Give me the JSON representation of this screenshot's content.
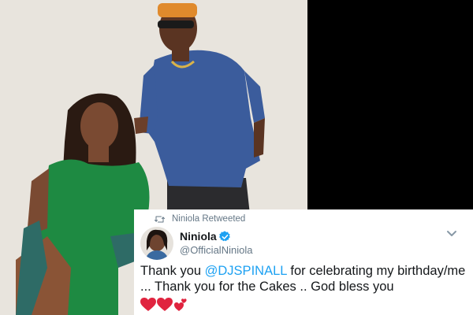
{
  "retweet": {
    "label": "Niniola Retweeted",
    "icon": "retweet-icon"
  },
  "author": {
    "name": "Niniola",
    "handle": "@OfficialNiniola",
    "verified_icon": "verified-badge-icon"
  },
  "tweet": {
    "line1_prefix": "Thank you ",
    "mention": "@DJSPINALL",
    "line1_suffix": " for celebrating my birthday/me",
    "line2": "... Thank you for the Cakes .. God bless you",
    "emojis": [
      "red-heart-icon",
      "red-heart-icon",
      "two-hearts-icon"
    ]
  },
  "colors": {
    "mention": "#1da1f2",
    "heart": "#e0243f",
    "verified": "#1da1f2",
    "muted": "#657786"
  }
}
